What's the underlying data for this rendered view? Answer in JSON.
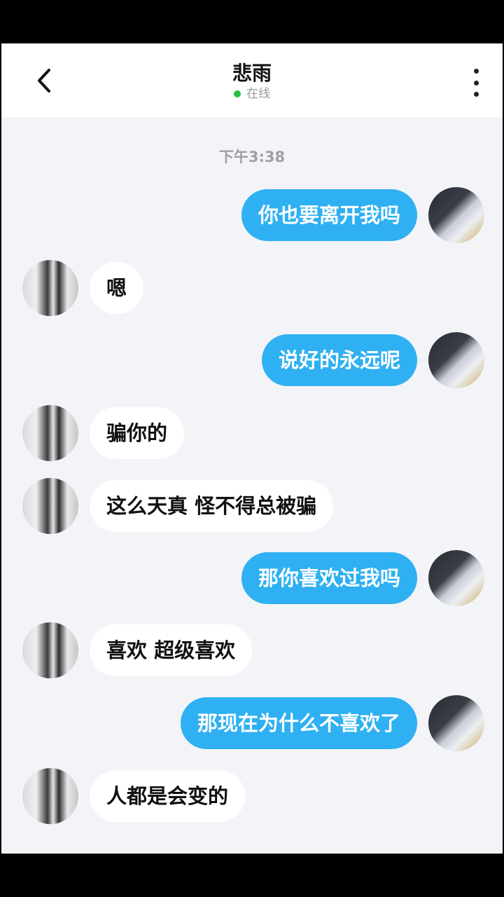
{
  "header": {
    "title": "悲雨",
    "status": "在线",
    "status_color": "#22c33a",
    "back_icon": "chevron-left-icon",
    "more_icon": "more-vertical-icon"
  },
  "chat": {
    "timestamp": "下午3:38",
    "messages": [
      {
        "side": "right",
        "text": "你也要离开我吗"
      },
      {
        "side": "left",
        "text": "嗯"
      },
      {
        "side": "right",
        "text": "说好的永远呢"
      },
      {
        "side": "left",
        "text": "骗你的"
      },
      {
        "side": "left",
        "text": "这么天真 怪不得总被骗"
      },
      {
        "side": "right",
        "text": "那你喜欢过我吗"
      },
      {
        "side": "left",
        "text": "喜欢 超级喜欢"
      },
      {
        "side": "right",
        "text": "那现在为什么不喜欢了"
      },
      {
        "side": "left",
        "text": "人都是会变的"
      }
    ]
  },
  "colors": {
    "sent_bubble": "#2fb0f2",
    "received_bubble": "#ffffff",
    "background": "#f3f4f8"
  }
}
